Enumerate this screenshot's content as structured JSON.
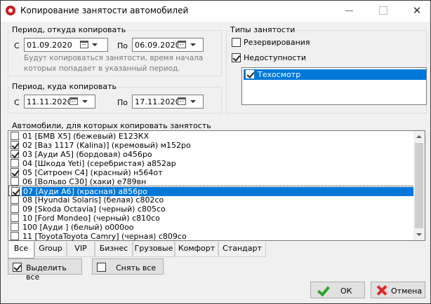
{
  "window": {
    "title": "Копирование занятости автомобилей",
    "close_glyph": "✕"
  },
  "source_period": {
    "legend": "Период, откуда копировать",
    "from_label": "С",
    "from_value": "01.09.2020",
    "to_label": "По",
    "to_value": "06.09.2020",
    "hint_line1": "Будут копироваться занятости, время начала",
    "hint_line2": "которых попадает в указанный период."
  },
  "target_period": {
    "legend": "Период, куда копировать",
    "from_label": "С",
    "from_value": "11.11.2020",
    "to_label": "По",
    "to_value": "17.11.2020"
  },
  "occupancy_types": {
    "legend": "Типы занятости",
    "reservations_label": "Резервирования",
    "reservations_checked": false,
    "unavailability_label": "Недоступности",
    "unavailability_checked": true,
    "items": [
      {
        "label": "Техосмотр",
        "checked": true,
        "selected": true
      }
    ]
  },
  "cars": {
    "legend": "Автомобили, для которых копировать занятость",
    "items": [
      {
        "label": "01 [БМВ X5] (бежевый) Е123КХ",
        "checked": false,
        "selected": false
      },
      {
        "label": "02 [Ваз 1117 (Kalina)] (кремовый) м152ро",
        "checked": true,
        "selected": false
      },
      {
        "label": "03 [Ауди А5] (бордовая) о456ро",
        "checked": true,
        "selected": false
      },
      {
        "label": "04 [Шкода Yeti] (серебристая) а852ар",
        "checked": false,
        "selected": false
      },
      {
        "label": "05 [Ситроен С4] (красный) н564от",
        "checked": true,
        "selected": false
      },
      {
        "label": "06 [Вольво С30] (хаки) е789вн",
        "checked": false,
        "selected": false
      },
      {
        "label": "07 [Ауди А6] (красная) а856ро",
        "checked": true,
        "selected": true
      },
      {
        "label": "08 [Hyundai Solaris] (белая) с802со",
        "checked": false,
        "selected": false
      },
      {
        "label": "09 [Skoda Octavia] (черный) с805со",
        "checked": false,
        "selected": false
      },
      {
        "label": "10 [Ford Mondeo] (черный) с810со",
        "checked": false,
        "selected": false
      },
      {
        "label": "100 [Ауди ] (белый) о000оо",
        "checked": false,
        "selected": false
      },
      {
        "label": "11 [ToyotaToyota Camry] (черная) с809со",
        "checked": false,
        "selected": false
      }
    ]
  },
  "tabs": [
    {
      "label": "Все",
      "active": true
    },
    {
      "label": "Group",
      "active": false
    },
    {
      "label": "VIP",
      "active": false
    },
    {
      "label": "Бизнес",
      "active": false
    },
    {
      "label": "Грузовые",
      "active": false
    },
    {
      "label": "Комфорт",
      "active": false
    },
    {
      "label": "Стандарт",
      "active": false
    }
  ],
  "actions": {
    "select_all_label": "Выделить все",
    "deselect_all_label": "Снять все",
    "ok_label": "ОК",
    "cancel_label": "Отмена"
  },
  "colors": {
    "selection": "#0078d7",
    "window_bg": "#f0f0f0",
    "ok_icon": "#2aa52a",
    "cancel_icon": "#e02a2a"
  }
}
